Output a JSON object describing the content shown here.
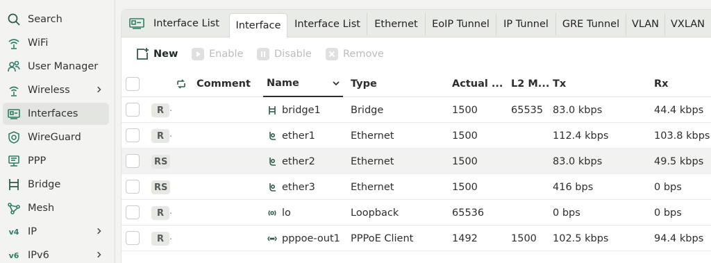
{
  "sidebar": {
    "items": [
      {
        "label": "Search",
        "icon": "search-icon",
        "chevron": false,
        "active": false
      },
      {
        "label": "WiFi",
        "icon": "wifi-icon",
        "chevron": false,
        "active": false
      },
      {
        "label": "User Manager",
        "icon": "user-manager-icon",
        "chevron": false,
        "active": false
      },
      {
        "label": "Wireless",
        "icon": "wireless-icon",
        "chevron": true,
        "active": false
      },
      {
        "label": "Interfaces",
        "icon": "interfaces-icon",
        "chevron": false,
        "active": true
      },
      {
        "label": "WireGuard",
        "icon": "wireguard-icon",
        "chevron": false,
        "active": false
      },
      {
        "label": "PPP",
        "icon": "ppp-icon",
        "chevron": false,
        "active": false
      },
      {
        "label": "Bridge",
        "icon": "bridge-icon",
        "chevron": false,
        "active": false
      },
      {
        "label": "Mesh",
        "icon": "mesh-icon",
        "chevron": false,
        "active": false
      },
      {
        "label": "IP",
        "icon": "ip-v4-icon",
        "chevron": true,
        "active": false
      },
      {
        "label": "IPv6",
        "icon": "ip-v6-icon",
        "chevron": true,
        "active": false
      }
    ]
  },
  "tabbar": {
    "title": "Interface List",
    "tabs": [
      {
        "label": "Interface",
        "active": true
      },
      {
        "label": "Interface List",
        "active": false
      },
      {
        "label": "Ethernet",
        "active": false
      },
      {
        "label": "EoIP Tunnel",
        "active": false
      },
      {
        "label": "IP Tunnel",
        "active": false
      },
      {
        "label": "GRE Tunnel",
        "active": false
      },
      {
        "label": "VLAN",
        "active": false
      },
      {
        "label": "VXLAN",
        "active": false
      }
    ]
  },
  "toolbar": {
    "new_label": "New",
    "enable_label": "Enable",
    "disable_label": "Disable",
    "remove_label": "Remove"
  },
  "table": {
    "columns": {
      "comment": "Comment",
      "name": "Name",
      "type": "Type",
      "actual_mtu": "Actual ...",
      "l2_mtu": "L2 M...",
      "tx": "Tx",
      "rx": "Rx"
    },
    "rows": [
      {
        "flag": "R",
        "name": "bridge1",
        "icon": "bridge-icon",
        "type": "Bridge",
        "actual_mtu": "1500",
        "l2_mtu": "65535",
        "tx": "83.0 kbps",
        "rx": "44.4 kbps"
      },
      {
        "flag": "R",
        "name": "ether1",
        "icon": "ethernet-icon",
        "type": "Ethernet",
        "actual_mtu": "1500",
        "l2_mtu": "",
        "tx": "112.4 kbps",
        "rx": "103.8 kbps"
      },
      {
        "flag": "RS",
        "name": "ether2",
        "icon": "ethernet-icon",
        "type": "Ethernet",
        "actual_mtu": "1500",
        "l2_mtu": "",
        "tx": "83.0 kbps",
        "rx": "49.5 kbps"
      },
      {
        "flag": "RS",
        "name": "ether3",
        "icon": "ethernet-icon",
        "type": "Ethernet",
        "actual_mtu": "1500",
        "l2_mtu": "",
        "tx": "416 bps",
        "rx": "0 bps"
      },
      {
        "flag": "R",
        "name": "lo",
        "icon": "loopback-icon",
        "type": "Loopback",
        "actual_mtu": "65536",
        "l2_mtu": "",
        "tx": "0 bps",
        "rx": "0 bps"
      },
      {
        "flag": "R",
        "name": "pppoe-out1",
        "icon": "pppoe-icon",
        "type": "PPPoE Client",
        "actual_mtu": "1492",
        "l2_mtu": "1500",
        "tx": "102.5 kbps",
        "rx": "94.4 kbps"
      }
    ]
  },
  "colors": {
    "accent": "#2e7d64",
    "active_bg": "#e3e5e1",
    "panel_bg": "#f3f4f2"
  }
}
